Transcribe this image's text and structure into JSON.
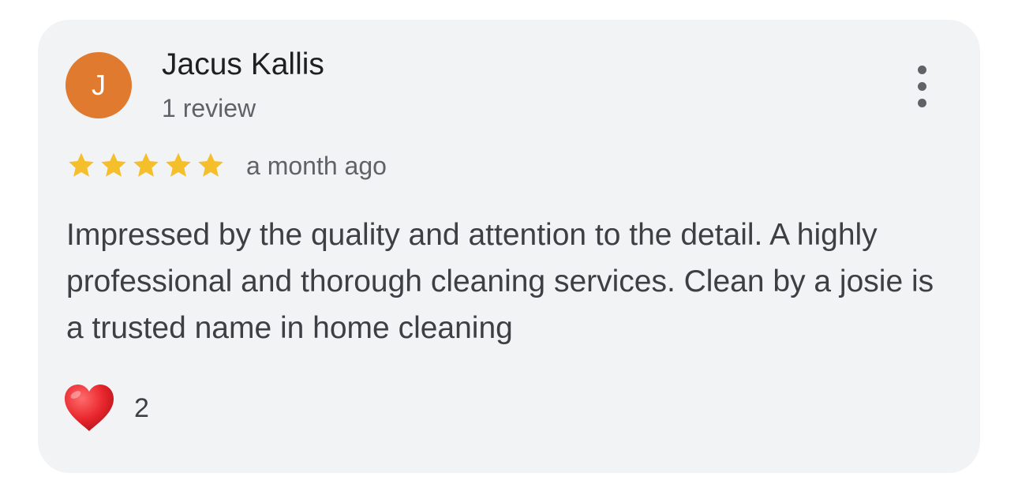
{
  "review": {
    "author": {
      "initial": "J",
      "name": "Jacus Kallis",
      "review_count": "1 review",
      "avatar_color": "#e07a2f"
    },
    "rating": 5,
    "rating_max": 5,
    "star_color": "#f4bf2a",
    "time_ago": "a month ago",
    "text": "Impressed by the quality and attention to the detail. A highly professional and thorough cleaning services. Clean by a josie is a trusted name in home cleaning",
    "reactions": {
      "icon": "heart-icon",
      "count": "2"
    },
    "menu_icon": "more-vert-icon"
  }
}
